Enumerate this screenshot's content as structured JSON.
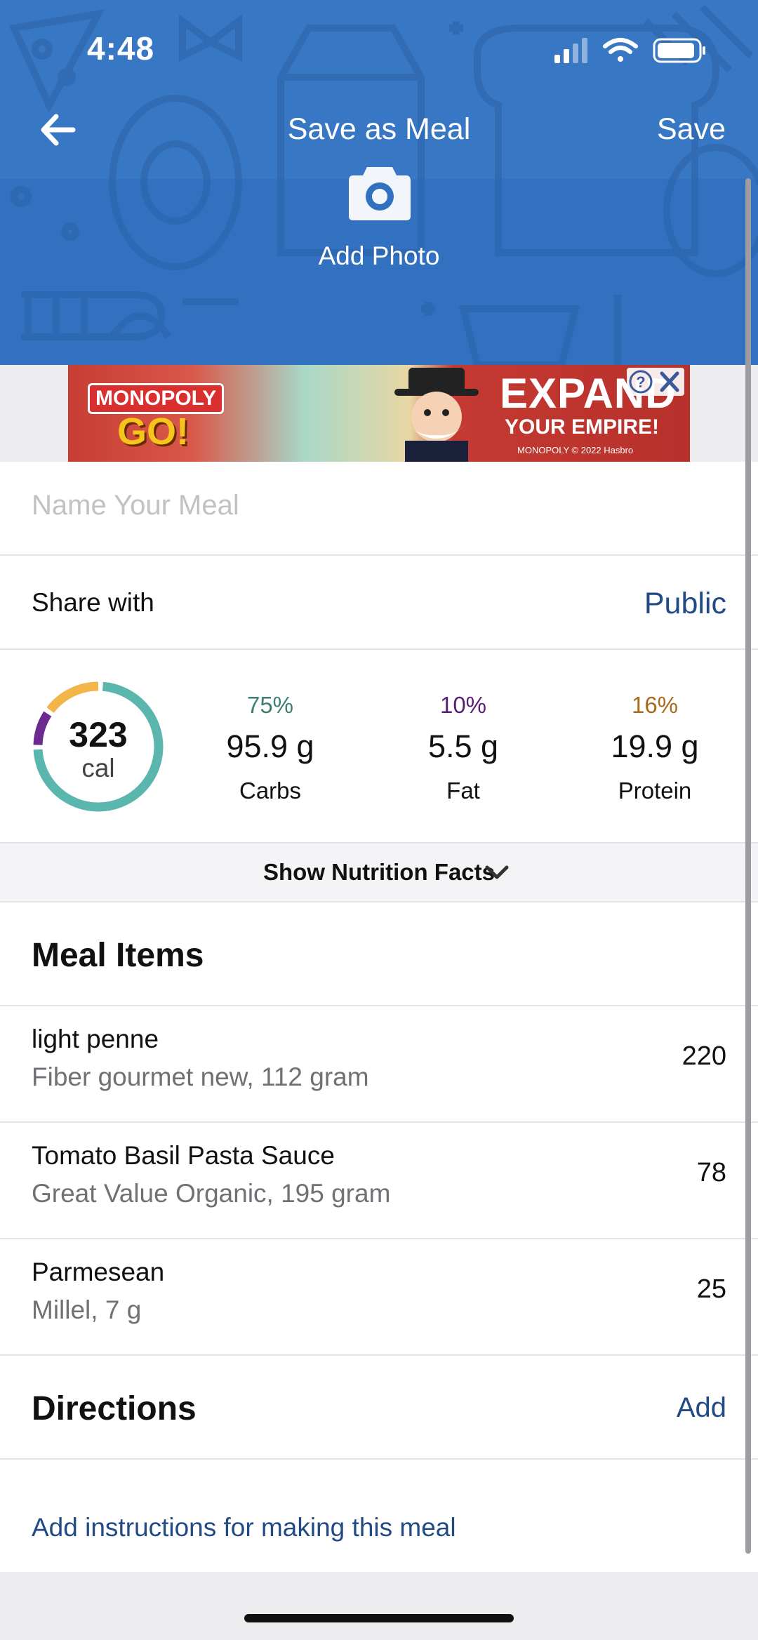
{
  "status_bar": {
    "time": "4:48"
  },
  "nav": {
    "title": "Save as Meal",
    "save_label": "Save"
  },
  "photo": {
    "label": "Add Photo"
  },
  "ad": {
    "brand_line1": "MONOPOLY",
    "brand_line2": "GO!",
    "headline": "EXPAND",
    "subline": "YOUR EMPIRE!",
    "legal": "MONOPOLY © 2022 Hasbro"
  },
  "meal_name": {
    "placeholder": "Name Your Meal",
    "value": ""
  },
  "share": {
    "label": "Share with",
    "value": "Public"
  },
  "summary": {
    "calories": "323",
    "calories_unit": "cal",
    "macros": [
      {
        "percent": "75%",
        "grams": "95.9 g",
        "name": "Carbs",
        "color": "#3e7f73",
        "fraction": 0.75
      },
      {
        "percent": "10%",
        "grams": "5.5 g",
        "name": "Fat",
        "color": "#5a1e75",
        "fraction": 0.1
      },
      {
        "percent": "16%",
        "grams": "19.9 g",
        "name": "Protein",
        "color": "#a86c1a",
        "fraction": 0.16
      }
    ],
    "ring_colors": {
      "carbs": "#5bb7ae",
      "fat": "#6b2a8f",
      "protein": "#f1b54a"
    }
  },
  "nutrition_toggle": {
    "label": "Show Nutrition Facts"
  },
  "meal_items": {
    "title": "Meal Items",
    "items": [
      {
        "name": "light penne",
        "detail": "Fiber gourmet new, 112 gram",
        "calories": "220"
      },
      {
        "name": "Tomato Basil Pasta Sauce",
        "detail": "Great Value Organic, 195 gram",
        "calories": "78"
      },
      {
        "name": "Parmesean",
        "detail": "Millel, 7 g",
        "calories": "25"
      }
    ]
  },
  "directions": {
    "title": "Directions",
    "add_label": "Add",
    "instructions_link": "Add instructions for making this meal"
  },
  "colors": {
    "header": "#3877c4",
    "link": "#224b86"
  }
}
